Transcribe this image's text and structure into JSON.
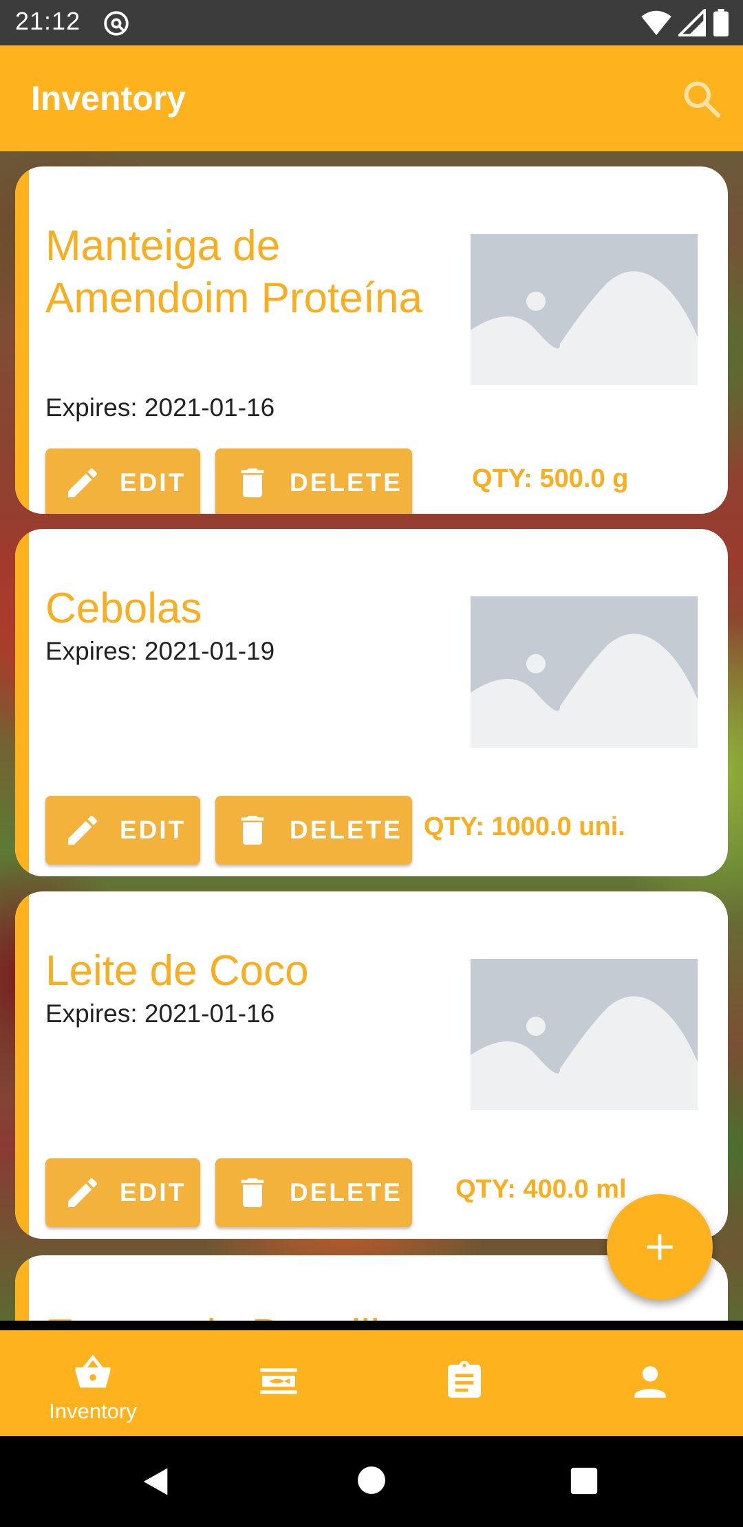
{
  "status_bar": {
    "time": "21:12"
  },
  "app_bar": {
    "title": "Inventory"
  },
  "items": [
    {
      "name": "Manteiga de Amendoim Proteína",
      "expiry": "Expires: 2021-01-16",
      "quantity": "QTY: 500.0 g",
      "edit_label": "EDIT",
      "delete_label": "DELETE"
    },
    {
      "name": "Cebolas",
      "expiry": "Expires: 2021-01-19",
      "quantity": "QTY: 1000.0 uni.",
      "edit_label": "EDIT",
      "delete_label": "DELETE"
    },
    {
      "name": "Leite de Coco",
      "expiry": "Expires: 2021-01-16",
      "quantity": "QTY: 400.0 ml",
      "edit_label": "EDIT",
      "delete_label": "DELETE"
    },
    {
      "name": "Extrato de Baunilha"
    }
  ],
  "bottom_nav": {
    "items": [
      {
        "label": "Inventory",
        "icon": "basket-icon",
        "active": true
      },
      {
        "label": "",
        "icon": "fish-icon"
      },
      {
        "label": "",
        "icon": "clipboard-icon"
      },
      {
        "label": "",
        "icon": "person-icon"
      }
    ]
  },
  "colors": {
    "primary": "#FDB21E",
    "button": "#F2B23C",
    "text_accent": "#F9AE1F"
  }
}
